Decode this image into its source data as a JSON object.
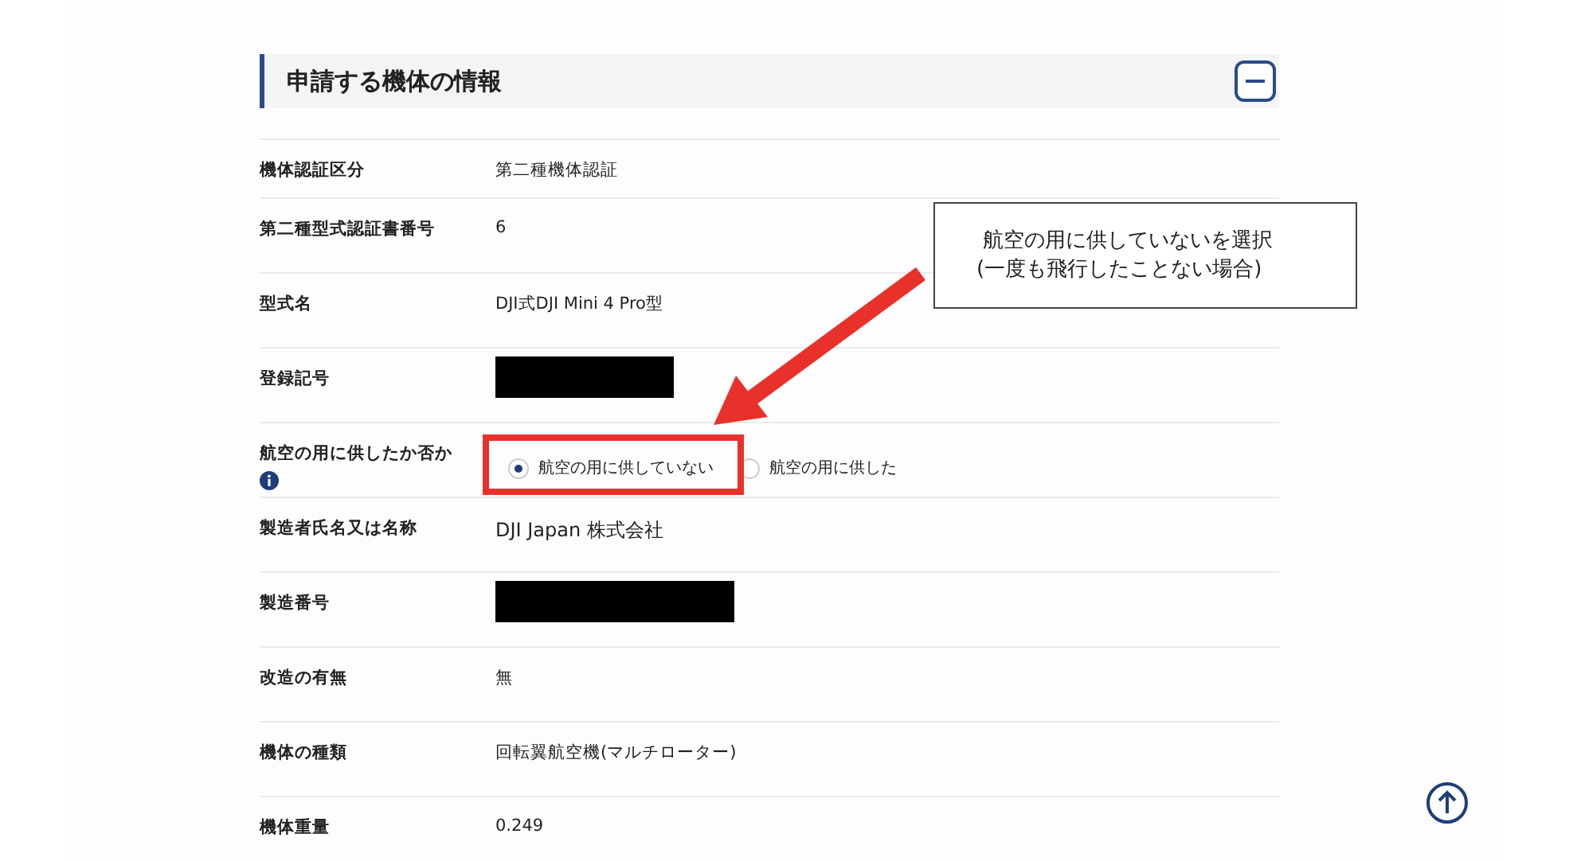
{
  "section": {
    "title": "申請する機体の情報",
    "expanded": true
  },
  "rows": [
    {
      "kind": "text",
      "label": "機体認証区分",
      "value": "第二種機体認証"
    },
    {
      "kind": "text",
      "label": "第二種型式認証書番号",
      "value": "6"
    },
    {
      "kind": "text",
      "label": "型式名",
      "value": "DJI式DJI Mini 4 Pro型"
    },
    {
      "kind": "redacted",
      "label": "登録記号"
    },
    {
      "kind": "radio",
      "label": "航空の用に供したか否か",
      "info": true,
      "options": [
        {
          "label": "航空の用に供していない",
          "selected": true
        },
        {
          "label": "航空の用に供した",
          "selected": false
        }
      ]
    },
    {
      "kind": "text",
      "label": "製造者氏名又は名称",
      "value": "DJI Japan 株式会社"
    },
    {
      "kind": "redacted",
      "label": "製造番号"
    },
    {
      "kind": "text",
      "label": "改造の有無",
      "value": "無"
    },
    {
      "kind": "text",
      "label": "機体の種類",
      "value": "回転翼航空機(マルチローター)"
    },
    {
      "kind": "text",
      "label": "機体重量",
      "value": "0.249"
    }
  ],
  "callout": {
    "lines": [
      "航空の用に供していないを選択",
      "(一度も飛行したことない場合)"
    ]
  }
}
